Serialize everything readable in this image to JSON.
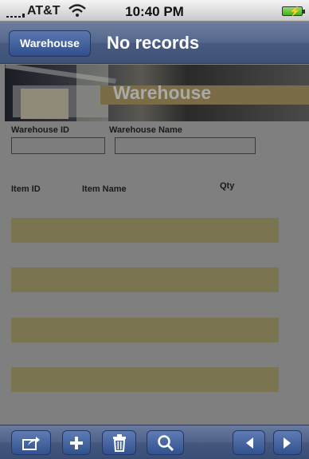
{
  "status_bar": {
    "carrier": "AT&T",
    "time": "10:40 PM"
  },
  "nav": {
    "back_label": "Warehouse",
    "title": "No records"
  },
  "banner": {
    "title": "Warehouse"
  },
  "form": {
    "warehouse_id_label": "Warehouse ID",
    "warehouse_name_label": "Warehouse Name",
    "warehouse_id_value": "",
    "warehouse_name_value": "",
    "columns": [
      "Item ID",
      "Item Name",
      "Qty"
    ],
    "rows": [
      {},
      {},
      {},
      {}
    ]
  },
  "toolbar": {
    "icons": [
      "share-icon",
      "add-icon",
      "trash-icon",
      "search-icon",
      "previous-icon",
      "next-icon"
    ]
  }
}
